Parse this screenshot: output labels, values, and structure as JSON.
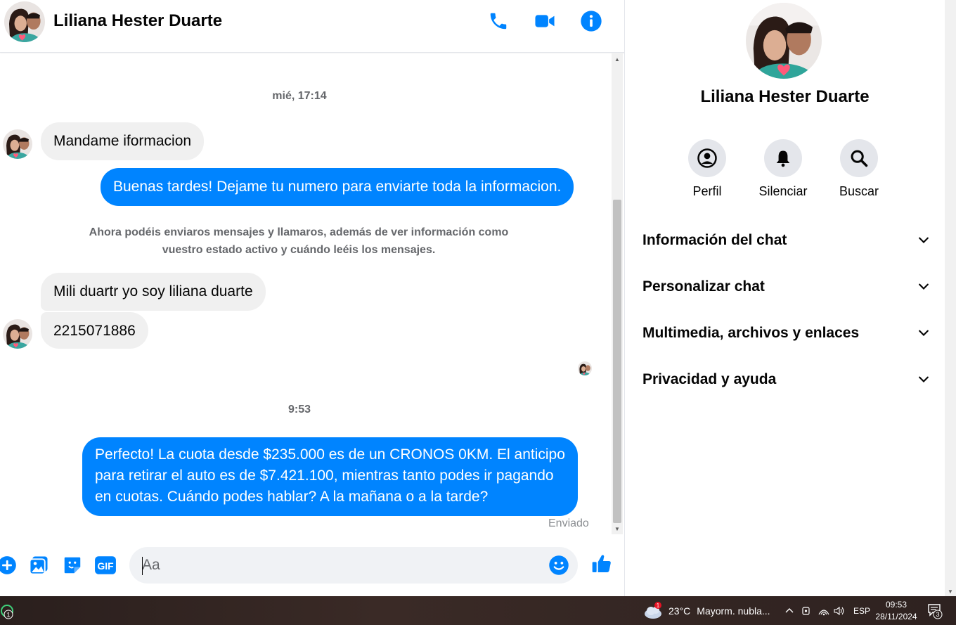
{
  "header": {
    "contact_name": "Liliana Hester Duarte",
    "icons": [
      "phone-icon",
      "video-icon",
      "info-icon"
    ]
  },
  "conversation": {
    "timestamps": [
      "mié, 17:14",
      "9:53"
    ],
    "messages": [
      {
        "direction": "in",
        "text": "Mandame iformacion"
      },
      {
        "direction": "out",
        "text": "Buenas tardes! Dejame tu numero para enviarte toda la informacion."
      },
      {
        "direction": "in",
        "text": "Mili duartr yo soy liliana duarte"
      },
      {
        "direction": "in",
        "text": "2215071886"
      },
      {
        "direction": "out",
        "lines": [
          "Perfecto! La cuota desde $235.000 es de un CRONOS 0KM. El anticipo",
          "para retirar el auto es de $7.421.100, mientras tanto podes ir pagando",
          "en cuotas. Cuándo podes hablar? A la mañana o a la tarde?"
        ]
      }
    ],
    "system_note_lines": [
      "Ahora podéis enviaros mensajes y llamaros, además de ver información como",
      "vuestro estado activo y cuándo leéis los mensajes."
    ],
    "sent_status": "Enviado"
  },
  "composer": {
    "placeholder": "Aa",
    "gif_label": "GIF",
    "icons": [
      "plus-icon",
      "image-icon",
      "sticker-icon",
      "gif-icon",
      "emoji-icon",
      "like-icon"
    ]
  },
  "panel": {
    "name": "Liliana Hester Duarte",
    "actions": [
      {
        "label": "Perfil",
        "icon": "profile-icon"
      },
      {
        "label": "Silenciar",
        "icon": "bell-icon"
      },
      {
        "label": "Buscar",
        "icon": "search-icon"
      }
    ],
    "sections": [
      "Información del chat",
      "Personalizar chat",
      "Multimedia, archivos y enlaces",
      "Privacidad y ayuda"
    ]
  },
  "taskbar": {
    "notification_count": "1",
    "weather_badge": "1",
    "temperature": "23°C",
    "weather_text": "Mayorm. nubla...",
    "language": "ESP",
    "time": "09:53",
    "date": "28/11/2024",
    "chat_badge": "3"
  },
  "colors": {
    "messenger_blue": "#0084ff",
    "incoming_bubble": "#f0f0f0",
    "muted_text": "#65676b",
    "circle_bg": "#e4e6eb"
  }
}
